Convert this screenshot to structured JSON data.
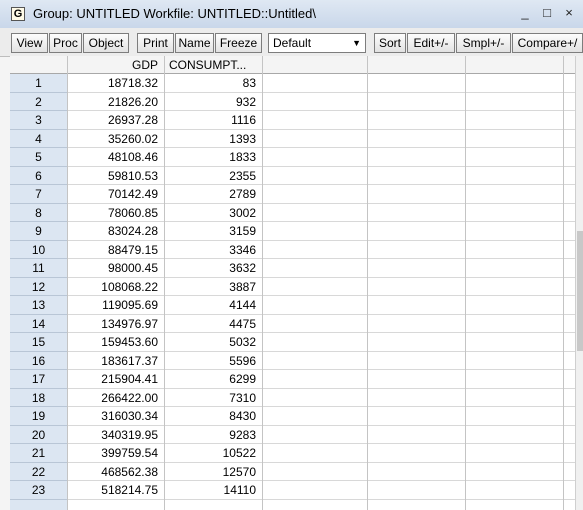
{
  "window": {
    "icon_letter": "G",
    "title": "Group: UNTITLED   Workfile: UNTITLED::Untitled\\",
    "minimize": "_",
    "maximize": "□",
    "close": "×"
  },
  "toolbar": {
    "buttons": [
      "View",
      "Proc",
      "Object",
      "Print",
      "Name",
      "Freeze",
      "Sort",
      "Edit+/-",
      "Smpl+/-",
      "Compare+/"
    ],
    "dropdown_value": "Default"
  },
  "grid": {
    "columns": [
      "GDP",
      "CONSUMPT..."
    ],
    "rows": [
      {
        "n": "1",
        "gdp": "18718.32",
        "cons": "83"
      },
      {
        "n": "2",
        "gdp": "21826.20",
        "cons": "932"
      },
      {
        "n": "3",
        "gdp": "26937.28",
        "cons": "1116"
      },
      {
        "n": "4",
        "gdp": "35260.02",
        "cons": "1393"
      },
      {
        "n": "5",
        "gdp": "48108.46",
        "cons": "1833"
      },
      {
        "n": "6",
        "gdp": "59810.53",
        "cons": "2355"
      },
      {
        "n": "7",
        "gdp": "70142.49",
        "cons": "2789"
      },
      {
        "n": "8",
        "gdp": "78060.85",
        "cons": "3002"
      },
      {
        "n": "9",
        "gdp": "83024.28",
        "cons": "3159"
      },
      {
        "n": "10",
        "gdp": "88479.15",
        "cons": "3346"
      },
      {
        "n": "11",
        "gdp": "98000.45",
        "cons": "3632"
      },
      {
        "n": "12",
        "gdp": "108068.22",
        "cons": "3887"
      },
      {
        "n": "13",
        "gdp": "119095.69",
        "cons": "4144"
      },
      {
        "n": "14",
        "gdp": "134976.97",
        "cons": "4475"
      },
      {
        "n": "15",
        "gdp": "159453.60",
        "cons": "5032"
      },
      {
        "n": "16",
        "gdp": "183617.37",
        "cons": "5596"
      },
      {
        "n": "17",
        "gdp": "215904.41",
        "cons": "6299"
      },
      {
        "n": "18",
        "gdp": "266422.00",
        "cons": "7310"
      },
      {
        "n": "19",
        "gdp": "316030.34",
        "cons": "8430"
      },
      {
        "n": "20",
        "gdp": "340319.95",
        "cons": "9283"
      },
      {
        "n": "21",
        "gdp": "399759.54",
        "cons": "10522"
      },
      {
        "n": "22",
        "gdp": "468562.38",
        "cons": "12570"
      },
      {
        "n": "23",
        "gdp": "518214.75",
        "cons": "14110"
      }
    ]
  }
}
